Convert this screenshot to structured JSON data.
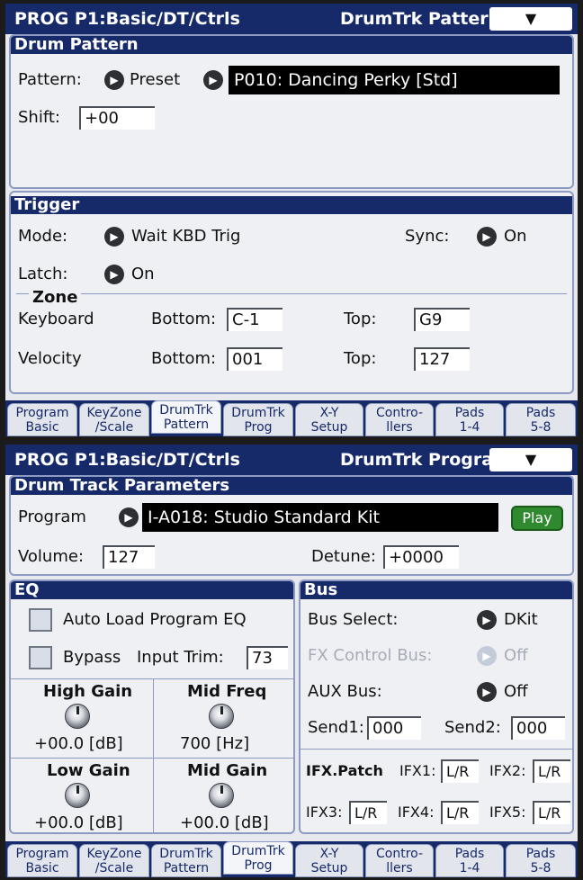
{
  "screen1": {
    "title_left": "PROG P1:Basic/DT/Ctrls",
    "title_right": "DrumTrk Pattern",
    "menu_icon": "chevron-down-icon",
    "menu_glyph": "▼",
    "drum_pattern": {
      "header": "Drum Pattern",
      "pattern_label": "Pattern:",
      "bank_value": "Preset",
      "pattern_value": "P010: Dancing Perky [Std]",
      "shift_label": "Shift:",
      "shift_value": "+00"
    },
    "trigger": {
      "header": "Trigger",
      "mode_label": "Mode:",
      "mode_value": "Wait KBD Trig",
      "sync_label": "Sync:",
      "sync_value": "On",
      "latch_label": "Latch:",
      "latch_value": "On",
      "zone_label": "Zone",
      "keyboard_label": "Keyboard",
      "keyboard_bottom_label": "Bottom:",
      "keyboard_bottom_value": "C-1",
      "keyboard_top_label": "Top:",
      "keyboard_top_value": "G9",
      "velocity_label": "Velocity",
      "velocity_bottom_label": "Bottom:",
      "velocity_bottom_value": "001",
      "velocity_top_label": "Top:",
      "velocity_top_value": "127"
    },
    "tabs": [
      {
        "label": "Program\nBasic"
      },
      {
        "label": "KeyZone\n/Scale"
      },
      {
        "label": "DrumTrk\nPattern"
      },
      {
        "label": "DrumTrk\nProg"
      },
      {
        "label": "X-Y\nSetup"
      },
      {
        "label": "Contro-\nllers"
      },
      {
        "label": "Pads\n1-4"
      },
      {
        "label": "Pads\n5-8"
      }
    ]
  },
  "screen2": {
    "title_left": "PROG P1:Basic/DT/Ctrls",
    "title_right": "DrumTrk Program",
    "menu_glyph": "▼",
    "params": {
      "header": "Drum Track Parameters",
      "program_label": "Program",
      "program_value": "I-A018: Studio Standard Kit",
      "play_label": "Play",
      "volume_label": "Volume:",
      "volume_value": "127",
      "detune_label": "Detune:",
      "detune_value": "+0000"
    },
    "eq": {
      "header": "EQ",
      "auto_load_label": "Auto Load Program EQ",
      "bypass_label": "Bypass",
      "input_trim_label": "Input Trim:",
      "input_trim_value": "73",
      "high_gain_label": "High Gain",
      "high_gain_value": "+00.0 [dB]",
      "mid_freq_label": "Mid Freq",
      "mid_freq_value": "700 [Hz]",
      "low_gain_label": "Low Gain",
      "low_gain_value": "+00.0 [dB]",
      "mid_gain_label": "Mid Gain",
      "mid_gain_value": "+00.0 [dB]"
    },
    "bus": {
      "header": "Bus",
      "bus_select_label": "Bus Select:",
      "bus_select_value": "DKit",
      "fx_control_label": "FX Control Bus:",
      "fx_control_value": "Off",
      "aux_label": "AUX Bus:",
      "aux_value": "Off",
      "send1_label": "Send1:",
      "send1_value": "000",
      "send2_label": "Send2:",
      "send2_value": "000",
      "ifx_patch_label": "IFX.Patch",
      "ifx1_label": "IFX1:",
      "ifx1_value": "L/R",
      "ifx2_label": "IFX2:",
      "ifx2_value": "L/R",
      "ifx3_label": "IFX3:",
      "ifx3_value": "L/R",
      "ifx4_label": "IFX4:",
      "ifx4_value": "L/R",
      "ifx5_label": "IFX5:",
      "ifx5_value": "L/R"
    },
    "tabs": [
      {
        "label": "Program\nBasic"
      },
      {
        "label": "KeyZone\n/Scale"
      },
      {
        "label": "DrumTrk\nPattern"
      },
      {
        "label": "DrumTrk\nProg"
      },
      {
        "label": "X-Y\nSetup"
      },
      {
        "label": "Contro-\nllers"
      },
      {
        "label": "Pads\n1-4"
      },
      {
        "label": "Pads\n5-8"
      }
    ]
  }
}
